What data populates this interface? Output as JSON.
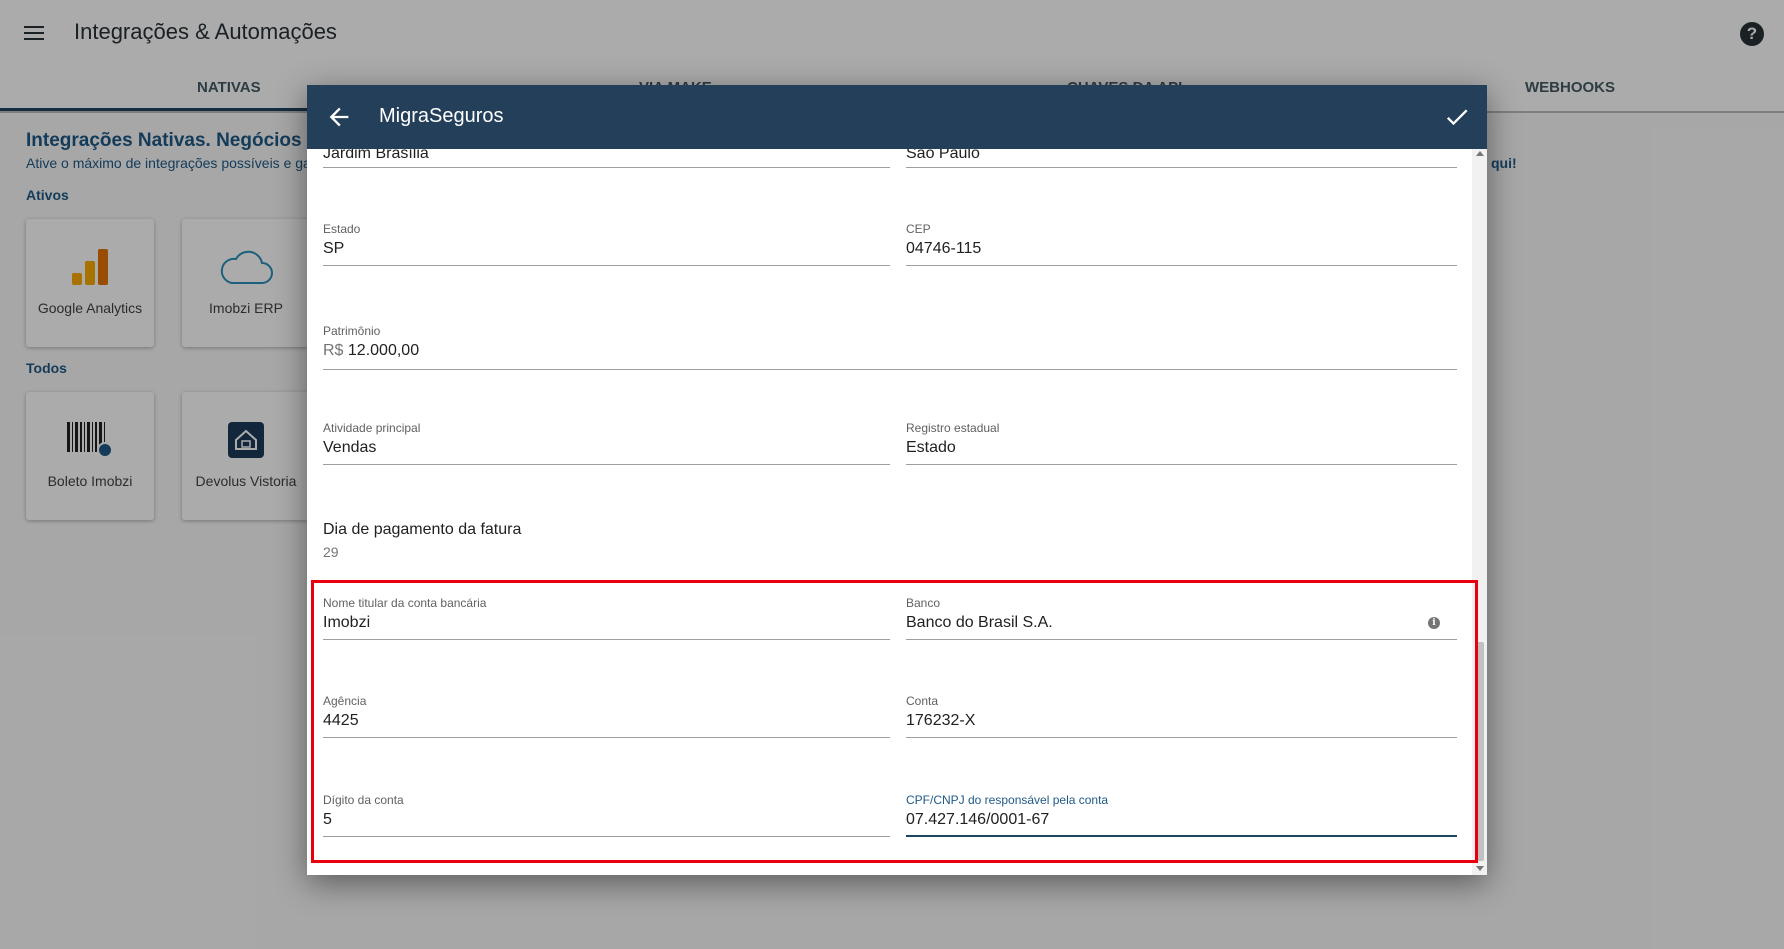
{
  "app": {
    "title": "Integrações & Automações",
    "help_symbol": "?"
  },
  "tabs": [
    {
      "label": "NATIVAS",
      "active": true
    },
    {
      "label": "VIA MAKE",
      "active": false
    },
    {
      "label": "CHAVES DA API",
      "active": false
    },
    {
      "label": "WEBHOOKS",
      "active": false
    }
  ],
  "main": {
    "heading": "Integrações Nativas. Negócios fech",
    "subheading": "Ative o máximo de integrações possíveis e gan",
    "right_link": "qui!",
    "ativos_label": "Ativos",
    "todos_label": "Todos",
    "ativos": [
      {
        "name": "Google Analytics",
        "icon": "google-analytics-icon"
      },
      {
        "name": "Imobzi ERP",
        "icon": "cloud-icon"
      }
    ],
    "todos": [
      {
        "name": "Boleto Imobzi",
        "icon": "barcode-icon"
      },
      {
        "name": "Devolus Vistoria",
        "icon": "devolus-icon"
      }
    ]
  },
  "dialog": {
    "title": "MigraSeguros",
    "fields": {
      "bairro": {
        "value": "Jardim Brasília"
      },
      "cidade": {
        "value": "São Paulo"
      },
      "estado": {
        "label": "Estado",
        "value": "SP"
      },
      "cep": {
        "label": "CEP",
        "value": "04746-115"
      },
      "patrimonio": {
        "label": "Patrimônio",
        "prefix": "R$",
        "value": "12.000,00"
      },
      "atividade": {
        "label": "Atividade principal",
        "value": "Vendas"
      },
      "registro": {
        "label": "Registro estadual",
        "value": "Estado"
      },
      "dia_pagamento": {
        "label": "Dia de pagamento da fatura",
        "value": "29"
      },
      "titular": {
        "label": "Nome titular da conta bancária",
        "value": "Imobzi"
      },
      "banco": {
        "label": "Banco",
        "value": "Banco do Brasil S.A."
      },
      "agencia": {
        "label": "Agência",
        "value": "4425"
      },
      "conta": {
        "label": "Conta",
        "value": "176232-X"
      },
      "digito": {
        "label": "Dígito da conta",
        "value": "5"
      },
      "cpf_cnpj": {
        "label": "CPF/CNPJ do responsável pela conta",
        "value": "07.427.146/0001-67"
      }
    }
  },
  "colors": {
    "dialog_header": "#233f59",
    "accent": "#1f5a86",
    "highlight": "#e8000f"
  }
}
